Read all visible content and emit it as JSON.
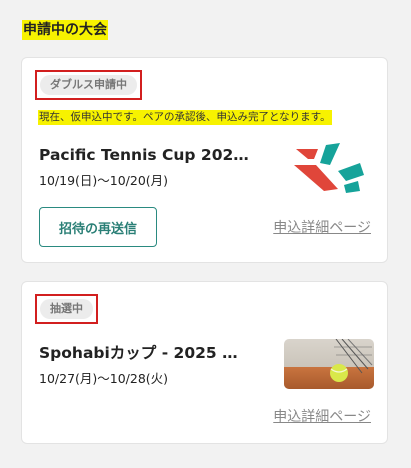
{
  "section": {
    "title": "申請中の大会"
  },
  "cards": [
    {
      "badge": "ダブルス申請中",
      "notice": "現在、仮申込中です。ペアの承認後、申込み完了となります。",
      "title": "Pacific Tennis Cup 202…",
      "dates": "10/19(日)〜10/20(月)",
      "resend_label": "招待の再送信",
      "detail_label": "申込詳細ページ",
      "image": "tournament-logo"
    },
    {
      "badge": "抽選中",
      "title": "Spohabiカップ - 2025 …",
      "dates": "10/27(月)〜10/28(火)",
      "detail_label": "申込詳細ページ",
      "image": "tennis-ball-photo"
    }
  ],
  "colors": {
    "accent": "#2a8a80",
    "highlight": "#f7f200",
    "outline": "#d21f1f",
    "logo_red": "#e0463a",
    "logo_teal": "#16a39a"
  }
}
